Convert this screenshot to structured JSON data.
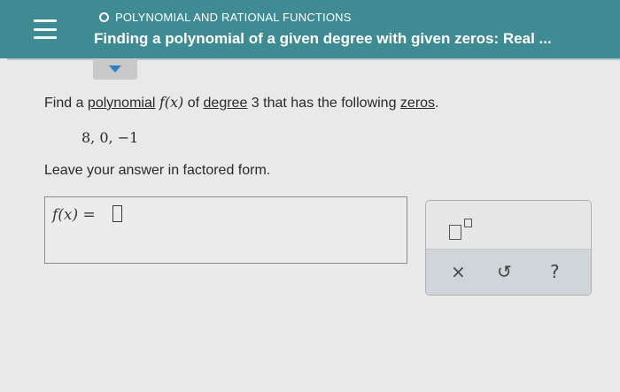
{
  "header": {
    "category": "POLYNOMIAL AND RATIONAL FUNCTIONS",
    "topic": "Finding a polynomial of a given degree with given zeros: Real ..."
  },
  "problem": {
    "prefix": "Find a ",
    "polynomial_link": "polynomial",
    "function": "f(x)",
    "middle": " of ",
    "degree_link": "degree",
    "middle2": " 3 that has the following ",
    "zeros_link": "zeros",
    "suffix": ".",
    "zeros_values": "8,  0,  −1",
    "instruction": "Leave your answer in factored form."
  },
  "answer": {
    "label": "f(x) ="
  },
  "tools": {
    "clear_label": "×",
    "undo_label": "↺",
    "help_label": "?"
  },
  "colors": {
    "header_bg": "#3e8b93",
    "tab_arrow": "#2f7fc3"
  }
}
